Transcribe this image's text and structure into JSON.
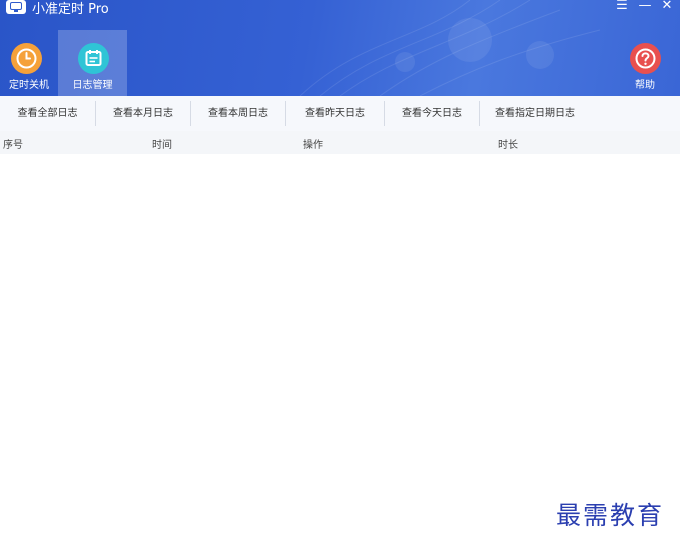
{
  "app": {
    "title": "小准定时 Pro",
    "window_controls": [
      "☰",
      "—",
      "✕"
    ]
  },
  "nav": [
    {
      "label": "定时关机",
      "icon": "clock-icon",
      "color": "#f5a13a",
      "active": false
    },
    {
      "label": "日志管理",
      "icon": "calendar-icon",
      "color": "#2fc4d6",
      "active": true
    },
    {
      "label": "帮助",
      "icon": "question-icon",
      "color": "#e8504f",
      "active": false
    }
  ],
  "toolbar": {
    "buttons": [
      "查看全部日志",
      "查看本月日志",
      "查看本周日志",
      "查看昨天日志",
      "查看今天日志",
      "查看指定日期日志"
    ]
  },
  "table": {
    "columns": [
      "序号",
      "时间",
      "操作",
      "时长"
    ],
    "rows": []
  },
  "watermark": "最需教育",
  "colors": {
    "header": "#3561d4",
    "toolbar_bg": "#f6f8fc",
    "table_header_bg": "#f4f6f9",
    "watermark": "#2b3fb0"
  }
}
